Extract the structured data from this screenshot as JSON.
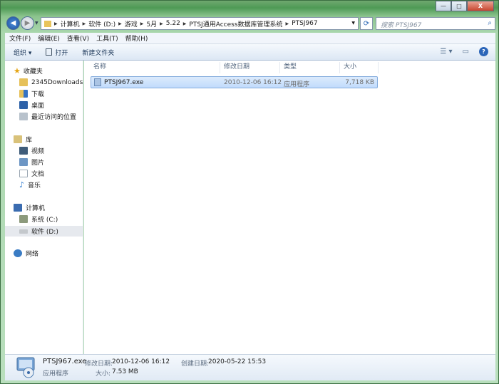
{
  "window": {
    "minimize": "—",
    "maximize": "□",
    "close": "X"
  },
  "address": {
    "crumbs": [
      "计算机",
      "软件 (D:)",
      "游戏",
      "5月",
      "5.22",
      "PTSJ通用Access数据库管理系统",
      "PTSJ967"
    ]
  },
  "search": {
    "placeholder": "搜索 PTSJ967"
  },
  "menu": [
    "文件(F)",
    "编辑(E)",
    "查看(V)",
    "工具(T)",
    "帮助(H)"
  ],
  "toolbar": {
    "organize": "组织 ▾",
    "open": "打开",
    "new_folder": "新建文件夹"
  },
  "sidebar": {
    "favorites": "收藏夹",
    "downloads2345": "2345Downloads",
    "downloads": "下载",
    "desktop": "桌面",
    "recent": "最近访问的位置",
    "libraries": "库",
    "videos": "视频",
    "pictures": "图片",
    "documents": "文档",
    "music": "音乐",
    "computer": "计算机",
    "drive_c": "系统 (C:)",
    "drive_d": "软件 (D:)",
    "network": "网络"
  },
  "columns": {
    "name": "名称",
    "modified": "修改日期",
    "type": "类型",
    "size": "大小"
  },
  "files": [
    {
      "name": "PTSJ967.exe",
      "modified": "2010-12-06 16:12",
      "type": "应用程序",
      "size": "7,718 KB"
    }
  ],
  "details": {
    "name": "PTSJ967.exe",
    "modified_label": "修改日期:",
    "modified": "2010-12-06 16:12",
    "created_label": "创建日期:",
    "created": "2020-05-22 15:53",
    "type": "应用程序",
    "size_label": "大小:",
    "size": "7.53 MB"
  }
}
